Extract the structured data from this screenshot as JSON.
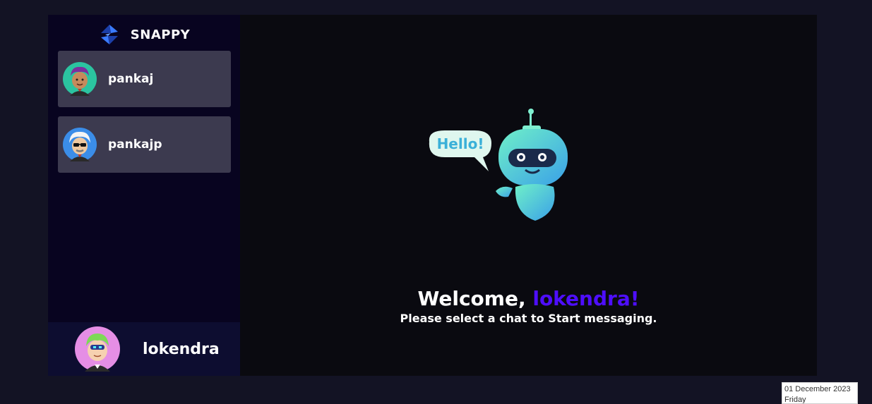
{
  "app": {
    "brand_name": "SNAPPY"
  },
  "contacts": [
    {
      "name": "pankaj",
      "avatar": "purple-haired man avatar"
    },
    {
      "name": "pankajp",
      "avatar": "white-haired man with sunglasses avatar"
    }
  ],
  "current_user": {
    "name": "lokendra",
    "avatar": "green-haired person with visor avatar"
  },
  "welcome": {
    "greeting": "Welcome, ",
    "username": "lokendra!",
    "subtitle": "Please select a chat to Start messaging.",
    "bubble_text": "Hello!"
  },
  "datebox": {
    "date": "01 December 2023",
    "day": "Friday"
  },
  "colors": {
    "background": "#131324",
    "sidebar": "#080420",
    "contact": "#3c3a4f",
    "accent": "#4e0eff",
    "chat_panel": "#0a0a10"
  }
}
